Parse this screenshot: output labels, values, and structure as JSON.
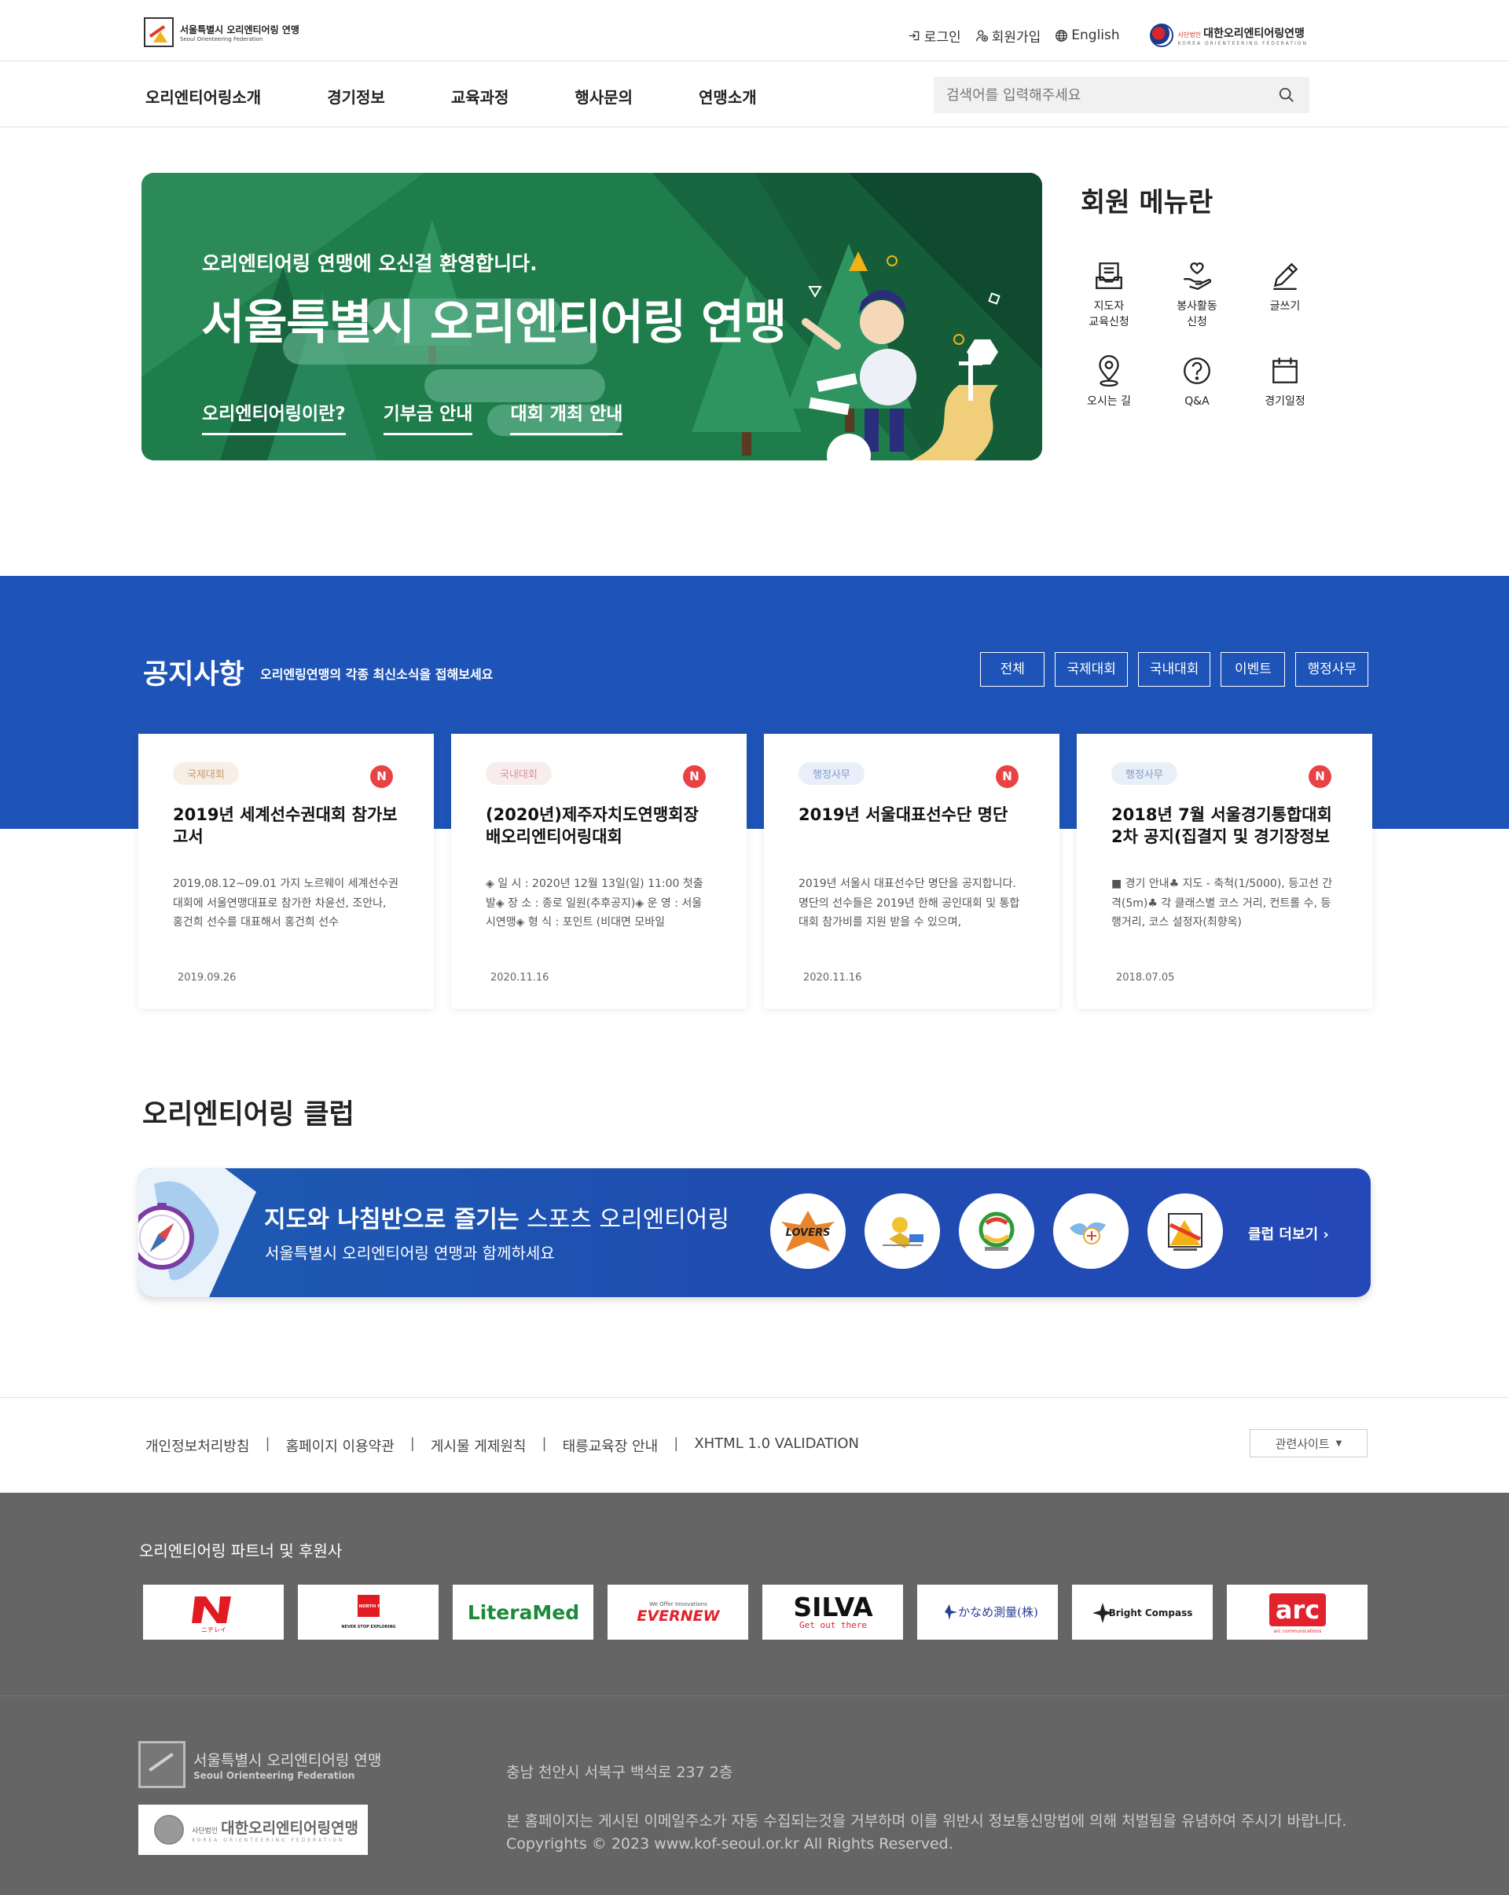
{
  "header": {
    "logo_line1": "서울특별시 오리엔티어링 연맹",
    "logo_line2": "Seoul Orienteering Federation",
    "utility": {
      "login": "로그인",
      "signup": "회원가입",
      "language": "English"
    },
    "kof": {
      "prefix": "사단법인",
      "name": "대한오리엔티어링연맹",
      "tagline": "KOREA ORIENTEERING FEDERATION"
    }
  },
  "nav": {
    "items": [
      "오리엔티어링소개",
      "경기정보",
      "교육과정",
      "행사문의",
      "연맹소개"
    ],
    "search_placeholder": "검색어를 입력해주세요"
  },
  "hero": {
    "subtitle": "오리엔티어링 연맹에 오신걸 환영합니다.",
    "title": "서울특별시 오리엔티어링 연맹",
    "links": [
      "오리엔티어링이란?",
      "기부금 안내",
      "대회 개최 안내"
    ],
    "colors": {
      "dark": "#0f4a30",
      "mid": "#1f7c4b",
      "light": "#3b9a68"
    }
  },
  "member_menu": {
    "title": "회원 메뉴란",
    "items": [
      {
        "label": "지도자\n교육신청",
        "icon": "document-tray-icon"
      },
      {
        "label": "봉사활동\n신청",
        "icon": "heart-hand-icon"
      },
      {
        "label": "글쓰기",
        "icon": "pencil-icon"
      },
      {
        "label": "오시는 길",
        "icon": "map-pin-icon"
      },
      {
        "label": "Q&A",
        "icon": "question-icon"
      },
      {
        "label": "경기일정",
        "icon": "calendar-icon"
      }
    ]
  },
  "notice": {
    "title": "공지사항",
    "description": "오리엔링연맹의 각종 최신소식을 접해보세요",
    "tabs": [
      "전체",
      "국제대회",
      "국내대회",
      "이벤트",
      "행정사무"
    ],
    "new_label": "N",
    "cards": [
      {
        "category": "국제대회",
        "title": "2019년 세계선수권대회 참가보고서",
        "body": "2019,08.12~09.01 가지 노르웨이 세계선수권대회에 서울연맹대표로 참가한 차윤선, 조안나, 홍건희 선수를 대표해서 홍건희 선수",
        "date": "2019.09.26"
      },
      {
        "category": "국내대회",
        "title": "(2020년)제주자치도연맹회장배오리엔티어링대회",
        "body": "◈ 일 시 : 2020년 12월 13일(일) 11:00 첫출발◈ 장 소 : 종로 일원(추후공지)◈ 운 영 : 서울시연맹◈ 형 식 : 포인트 (비대면 모바일",
        "date": "2020.11.16"
      },
      {
        "category": "행정사무",
        "title": "2019년 서울대표선수단 명단",
        "body": "2019년 서울시 대표선수단 명단을 공지합니다.명단의 선수들은 2019년 한해 공인대회 및 통합대회 참가비를 지원 받을 수 있으며,",
        "date": "2020.11.16"
      },
      {
        "category": "행정사무",
        "title": "2018년 7월 서울경기통합대회 2차 공지(집결지 및 경기장정보",
        "body": "■ 경기 안내♣ 지도 - 축척(1/5000), 등고선 간격(5m)♣ 각 클래스별 코스 거리, 컨트롤 수, 등행거리, 코스 설정자(최향옥)",
        "date": "2018.07.05"
      }
    ]
  },
  "club": {
    "title": "오리엔티어링 클럽",
    "headline_bold": "지도와 나침반으로 즐기는",
    "headline_rest": " 스포츠 오리엔티어링",
    "subline": "서울특별시 오리엔티어링 연맹과 함께하세요",
    "logos": [
      "LOVERS",
      "club-logo-2",
      "club-logo-3",
      "club-logo-4",
      "club-logo-5"
    ],
    "more": "클럽 더보기"
  },
  "footer": {
    "links": [
      "개인정보처리방침",
      "홈페이지 이용약관",
      "게시물 게제원칙",
      "태릉교육장 안내",
      "XHTML 1.0 VALIDATION"
    ],
    "related": "관련사이트",
    "partners_title": "오리엔티어링 파트너 및 후원사",
    "partners": [
      "ニチレイ",
      "THE NORTH FACE",
      "LiteraMed",
      "EVERNEW",
      "SILVA",
      "かなめ測量(株)",
      "Bright Compass",
      "arc"
    ],
    "partner_extra": {
      "tnf_tag": "NEVER STOP EXPLORING",
      "evernew_tag": "We Offer Innovations",
      "silva_tag": "Get out there",
      "arc_tag": "arc communications"
    },
    "logo1_line1": "서울특별시 오리엔티어링 연맹",
    "logo1_line2": "Seoul Orienteering Federation",
    "logo2_prefix": "사단법인",
    "logo2_name": "대한오리엔티어링연맹",
    "logo2_tag": "KOREA ORIENTEERING FEDERATION",
    "address": "충남 천안시 서북구 백석로 237 2층",
    "notice": "본 홈페이지는 게시된 이메일주소가 자동 수집되는것을 거부하며 이를 위반시 정보통신망법에 의해 처벌됨을 유념하여 주시기 바랍니다.",
    "copyright": "Copyrights © 2023 www.kof-seoul.or.kr All Rights Reserved."
  }
}
